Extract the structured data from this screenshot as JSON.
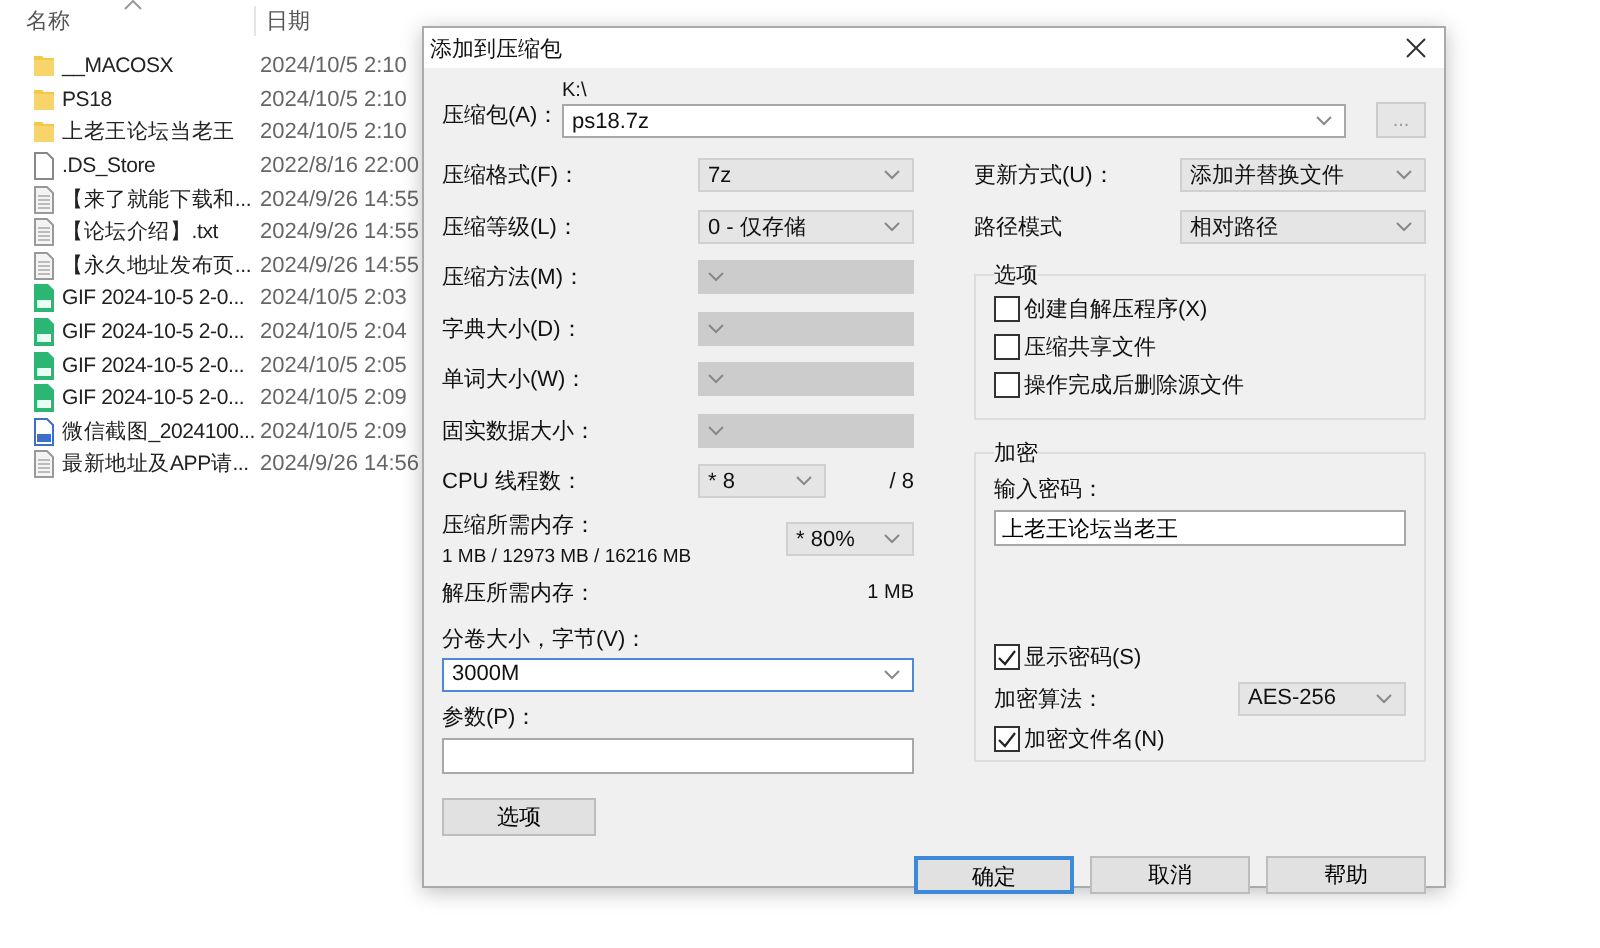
{
  "explorer": {
    "columns": [
      {
        "label": "名称",
        "sorted": true
      },
      {
        "label": "日期",
        "sorted": false
      }
    ],
    "files": [
      {
        "kind": "folder",
        "name": "__MACOSX",
        "date": "2024/10/5 2:10"
      },
      {
        "kind": "folder",
        "name": "PS18",
        "date": "2024/10/5 2:10"
      },
      {
        "kind": "folder",
        "name": "上老王论坛当老王",
        "date": "2024/10/5 2:10"
      },
      {
        "kind": "blank",
        "name": ".DS_Store",
        "date": "2022/8/16 22:00"
      },
      {
        "kind": "text",
        "name": "【来了就能下载和...",
        "date": "2024/9/26 14:55"
      },
      {
        "kind": "text",
        "name": "【论坛介绍】.txt",
        "date": "2024/9/26 14:55"
      },
      {
        "kind": "text",
        "name": "【永久地址发布页...",
        "date": "2024/9/26 14:55"
      },
      {
        "kind": "gif",
        "name": "GIF 2024-10-5 2-0...",
        "date": "2024/10/5 2:03"
      },
      {
        "kind": "gif",
        "name": "GIF 2024-10-5 2-0...",
        "date": "2024/10/5 2:04"
      },
      {
        "kind": "gif",
        "name": "GIF 2024-10-5 2-0...",
        "date": "2024/10/5 2:05"
      },
      {
        "kind": "gif",
        "name": "GIF 2024-10-5 2-0...",
        "date": "2024/10/5 2:09"
      },
      {
        "kind": "image",
        "name": "微信截图_2024100...",
        "date": "2024/10/5 2:09"
      },
      {
        "kind": "text",
        "name": "最新地址及APP请...",
        "date": "2024/9/26 14:56"
      }
    ]
  },
  "dialog": {
    "title": "添加到压缩包",
    "archive": {
      "label": "压缩包(A)：",
      "folder": "K:\\",
      "value": "ps18.7z",
      "browse": "..."
    },
    "settings": [
      {
        "kind": "select",
        "label": "压缩格式(F)：",
        "value": "7z",
        "disabled": false
      },
      {
        "kind": "select",
        "label": "压缩等级(L)：",
        "value": "0 - 仅存储",
        "disabled": false
      },
      {
        "kind": "select",
        "label": "压缩方法(M)：",
        "disabled": true
      },
      {
        "kind": "select",
        "label": "字典大小(D)：",
        "disabled": true
      },
      {
        "kind": "select",
        "label": "单词大小(W)：",
        "disabled": true
      },
      {
        "kind": "select",
        "label": "固实数据大小：",
        "disabled": true
      },
      {
        "kind": "threads",
        "label": "CPU 线程数：",
        "value": "* 8",
        "suffix": "/ 8"
      },
      {
        "kind": "memory",
        "label": "压缩所需内存：",
        "detail": "1 MB / 12973 MB / 16216 MB",
        "value": "* 80%"
      },
      {
        "kind": "info",
        "label": "解压所需内存：",
        "value": "1 MB"
      }
    ],
    "volume": {
      "label": "分卷大小，字节(V)：",
      "value": "3000M"
    },
    "parameters": {
      "label": "参数(P)："
    },
    "options_button": "选项",
    "update": {
      "label": "更新方式(U)：",
      "value": "添加并替换文件"
    },
    "path_mode": {
      "label": "路径模式",
      "value": "相对路径"
    },
    "options": {
      "title": "选项",
      "items": [
        {
          "label": "创建自解压程序(X)",
          "checked": false
        },
        {
          "label": "压缩共享文件",
          "checked": false
        },
        {
          "label": "操作完成后删除源文件",
          "checked": false
        }
      ]
    },
    "encryption": {
      "title": "加密",
      "password_label": "输入密码：",
      "password": "上老王论坛当老王",
      "show_password": {
        "label": "显示密码(S)",
        "checked": true
      },
      "method": {
        "label": "加密算法：",
        "value": "AES-256"
      },
      "encrypt_names": {
        "label": "加密文件名(N)",
        "checked": true
      }
    },
    "buttons": [
      {
        "label": "确定",
        "default": true
      },
      {
        "label": "取消",
        "default": false
      },
      {
        "label": "帮助",
        "default": false
      }
    ]
  }
}
